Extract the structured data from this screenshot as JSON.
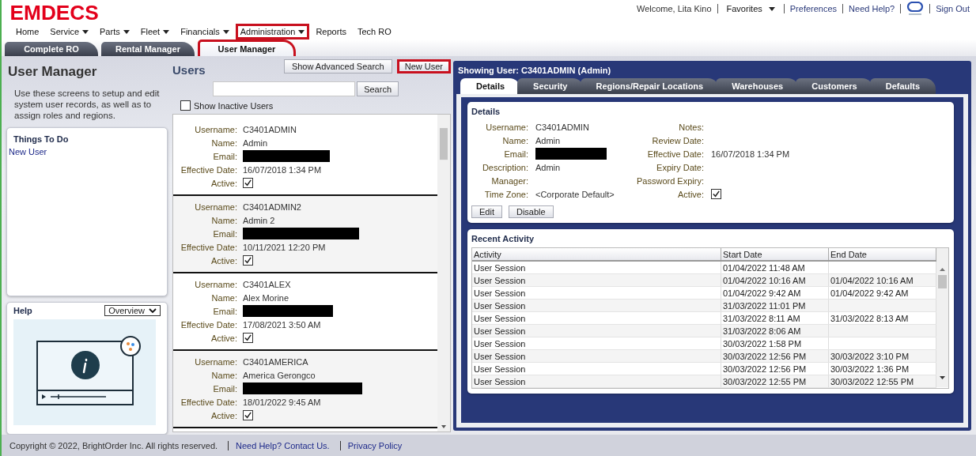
{
  "header": {
    "logo": "EMDECS",
    "welcome": "Welcome, Lita Kino",
    "links": [
      {
        "kind": "menu",
        "label": "Favorites"
      },
      {
        "kind": "link",
        "label": "Preferences"
      },
      {
        "kind": "link",
        "label": "Need Help?"
      },
      {
        "kind": "icon"
      },
      {
        "kind": "link",
        "label": "Sign Out"
      }
    ]
  },
  "nav": [
    {
      "label": "Home",
      "has_menu": false,
      "highlighted": false
    },
    {
      "label": "Service",
      "has_menu": true,
      "highlighted": false
    },
    {
      "label": "Parts",
      "has_menu": true,
      "highlighted": false
    },
    {
      "label": "Fleet",
      "has_menu": true,
      "highlighted": false
    },
    {
      "label": "Financials",
      "has_menu": true,
      "highlighted": false
    },
    {
      "label": "Administration",
      "has_menu": true,
      "highlighted": true
    },
    {
      "label": "Reports",
      "has_menu": false,
      "highlighted": false
    },
    {
      "label": "Tech RO",
      "has_menu": false,
      "highlighted": false
    }
  ],
  "app_tabs": [
    {
      "label": "Complete RO",
      "selected": false,
      "highlighted": false
    },
    {
      "label": "Rental Manager",
      "selected": false,
      "highlighted": false
    },
    {
      "label": "User Manager",
      "selected": true,
      "highlighted": true
    }
  ],
  "sidebar": {
    "title": "User Manager",
    "description": "Use these screens to setup and edit system user records, as well as to assign roles and regions.",
    "todo": {
      "title": "Things To Do",
      "links": [
        "New User"
      ]
    },
    "help": {
      "title": "Help",
      "dropdown": "Overview"
    }
  },
  "users": {
    "title": "Users",
    "buttons": [
      {
        "label": "Show Advanced Search",
        "highlighted": false
      },
      {
        "label": "New User",
        "highlighted": true
      }
    ],
    "search_button": "Search",
    "show_inactive": {
      "label": "Show Inactive Users",
      "checked": false
    },
    "cards": [
      {
        "fields": [
          {
            "kind": "text",
            "label": "Username:",
            "value": "C3401ADMIN"
          },
          {
            "kind": "text",
            "label": "Name:",
            "value": "Admin"
          },
          {
            "kind": "redacted",
            "label": "Email:"
          },
          {
            "kind": "text",
            "label": "Effective Date:",
            "value": "16/07/2018 1:34 PM"
          },
          {
            "kind": "checkbox",
            "label": "Active:",
            "checked": true
          }
        ]
      },
      {
        "fields": [
          {
            "kind": "text",
            "label": "Username:",
            "value": "C3401ADMIN2"
          },
          {
            "kind": "text",
            "label": "Name:",
            "value": "Admin 2"
          },
          {
            "kind": "redacted",
            "label": "Email:"
          },
          {
            "kind": "text",
            "label": "Effective Date:",
            "value": "10/11/2021 12:20 PM"
          },
          {
            "kind": "checkbox",
            "label": "Active:",
            "checked": true
          }
        ]
      },
      {
        "fields": [
          {
            "kind": "text",
            "label": "Username:",
            "value": "C3401ALEX"
          },
          {
            "kind": "text",
            "label": "Name:",
            "value": "Alex Morine"
          },
          {
            "kind": "redacted",
            "label": "Email:"
          },
          {
            "kind": "text",
            "label": "Effective Date:",
            "value": "17/08/2021 3:50 AM"
          },
          {
            "kind": "checkbox",
            "label": "Active:",
            "checked": true
          }
        ]
      },
      {
        "fields": [
          {
            "kind": "text",
            "label": "Username:",
            "value": "C3401AMERICA"
          },
          {
            "kind": "text",
            "label": "Name:",
            "value": "America Gerongco"
          },
          {
            "kind": "redacted",
            "label": "Email:"
          },
          {
            "kind": "text",
            "label": "Effective Date:",
            "value": "18/01/2022 9:45 AM"
          },
          {
            "kind": "checkbox",
            "label": "Active:",
            "checked": true
          }
        ]
      }
    ]
  },
  "user_panel": {
    "title": "Showing User: C3401ADMIN (Admin)",
    "tabs": [
      {
        "label": "Details",
        "selected": true
      },
      {
        "label": "Security",
        "selected": false
      },
      {
        "label": "Regions/Repair Locations",
        "selected": false
      },
      {
        "label": "Warehouses",
        "selected": false
      },
      {
        "label": "Customers",
        "selected": false
      },
      {
        "label": "Defaults",
        "selected": false
      }
    ],
    "details": {
      "title": "Details",
      "left": [
        {
          "kind": "text",
          "label": "Username:",
          "value": "C3401ADMIN"
        },
        {
          "kind": "text",
          "label": "Name:",
          "value": "Admin"
        },
        {
          "kind": "redacted",
          "label": "Email:"
        },
        {
          "kind": "text",
          "label": "Description:",
          "value": "Admin"
        },
        {
          "kind": "text",
          "label": "Manager:"
        },
        {
          "kind": "text",
          "label": "Time Zone:",
          "value": "<Corporate Default>"
        }
      ],
      "right": [
        {
          "kind": "text",
          "label": "Notes:"
        },
        {
          "kind": "text",
          "label": "Review Date:"
        },
        {
          "kind": "text",
          "label": "Effective Date:",
          "value": "16/07/2018 1:34 PM"
        },
        {
          "kind": "text",
          "label": "Expiry Date:"
        },
        {
          "kind": "text",
          "label": "Password Expiry:"
        },
        {
          "kind": "checkbox",
          "label": "Active:",
          "checked": true
        }
      ],
      "buttons": [
        "Edit",
        "Disable"
      ]
    },
    "activity": {
      "title": "Recent Activity",
      "columns": [
        "Activity",
        "Start Date",
        "End Date"
      ],
      "rows": [
        {
          "activity": "User Session",
          "start": "01/04/2022 11:48 AM"
        },
        {
          "activity": "User Session",
          "start": "01/04/2022 10:16 AM",
          "end": "01/04/2022 10:16 AM"
        },
        {
          "activity": "User Session",
          "start": "01/04/2022 9:42 AM",
          "end": "01/04/2022 9:42 AM"
        },
        {
          "activity": "User Session",
          "start": "31/03/2022 11:01 PM"
        },
        {
          "activity": "User Session",
          "start": "31/03/2022 8:11 AM",
          "end": "31/03/2022 8:13 AM"
        },
        {
          "activity": "User Session",
          "start": "31/03/2022 8:06 AM"
        },
        {
          "activity": "User Session",
          "start": "30/03/2022 1:58 PM"
        },
        {
          "activity": "User Session",
          "start": "30/03/2022 12:56 PM",
          "end": "30/03/2022 3:10 PM"
        },
        {
          "activity": "User Session",
          "start": "30/03/2022 12:56 PM",
          "end": "30/03/2022 1:36 PM"
        },
        {
          "activity": "User Session",
          "start": "30/03/2022 12:55 PM",
          "end": "30/03/2022 12:55 PM"
        }
      ]
    }
  },
  "footer": {
    "copyright": "Copyright © 2022, BrightOrder Inc. All rights reserved.",
    "links": [
      "Need Help? Contact Us.",
      "Privacy Policy"
    ]
  }
}
